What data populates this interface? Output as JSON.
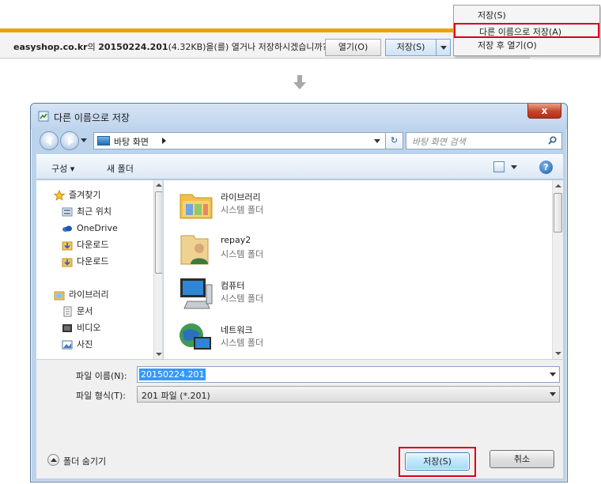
{
  "download_bar": {
    "site": "easyshop.co.kr",
    "connector": "의 ",
    "filename": "20150224.201",
    "size_text": "(4.32KB)을(를) 열거나 저장하시겠습니까?",
    "open_label": "열기(O)",
    "save_label": "저장(S)"
  },
  "save_menu": {
    "items": [
      {
        "label": "저장(S)"
      },
      {
        "label": "다른 이름으로 저장(A)"
      },
      {
        "label": "저장 후 열기(O)"
      }
    ]
  },
  "dialog": {
    "title": "다른 이름으로 저장",
    "close_label": "x",
    "address": "바탕 화면",
    "search_placeholder": "바탕 화면 검색",
    "toolbar": {
      "organize": "구성 ▾",
      "new_folder": "새 폴더",
      "help": "?"
    },
    "nav": [
      {
        "label": "즐겨찾기",
        "icon": "star-icon"
      },
      {
        "label": "최근 위치",
        "icon": "recent-places-icon"
      },
      {
        "label": "OneDrive",
        "icon": "cloud-icon"
      },
      {
        "label": "다운로드",
        "icon": "download-folder-icon"
      },
      {
        "label": "다운로드",
        "icon": "download-folder-icon"
      },
      {
        "label": "라이브러리",
        "icon": "library-icon"
      },
      {
        "label": "문서",
        "icon": "document-icon"
      },
      {
        "label": "비디오",
        "icon": "video-icon"
      },
      {
        "label": "사진",
        "icon": "picture-icon"
      }
    ],
    "items": [
      {
        "name": "라이브러리",
        "type": "시스템 폴더",
        "icon": "library-folder-icon"
      },
      {
        "name": "repay2",
        "type": "시스템 폴더",
        "icon": "user-folder-icon"
      },
      {
        "name": "컴퓨터",
        "type": "시스템 폴더",
        "icon": "computer-icon"
      },
      {
        "name": "네트워크",
        "type": "시스템 폴더",
        "icon": "network-icon"
      }
    ],
    "filename_label": "파일 이름(N):",
    "filename_value": "20150224.201",
    "filetype_label": "파일 형식(T):",
    "filetype_value": "201 파일 (*.201)",
    "hide_folders": "폴더 숨기기",
    "save_button": "저장(S)",
    "cancel_button": "취소"
  },
  "colors": {
    "accent_bar": "#e8a500",
    "highlight_border": "#d6001c",
    "selection": "#3399ff",
    "title_bar": "#bfd4ec"
  }
}
